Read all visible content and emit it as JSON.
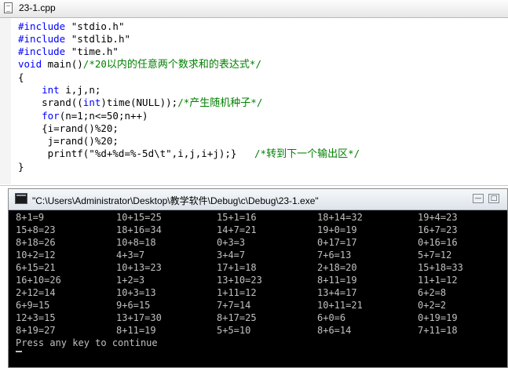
{
  "editor": {
    "title": "23-1.cpp",
    "lines": [
      [
        {
          "t": "#include",
          "c": "kw"
        },
        {
          "t": " \"stdio.h\""
        }
      ],
      [
        {
          "t": "#include",
          "c": "kw"
        },
        {
          "t": " \"stdlib.h\""
        }
      ],
      [
        {
          "t": "#include",
          "c": "kw"
        },
        {
          "t": " \"time.h\""
        }
      ],
      [
        {
          "t": "void",
          "c": "kw"
        },
        {
          "t": " main()"
        },
        {
          "t": "/*20",
          "c": "cm"
        },
        {
          "t": "以内的任意两个数求和的表达式",
          "c": "cmz"
        },
        {
          "t": "*/",
          "c": "cm"
        }
      ],
      [
        {
          "t": "{"
        }
      ],
      [
        {
          "t": "    "
        },
        {
          "t": "int",
          "c": "kw"
        },
        {
          "t": " i,j,n;"
        }
      ],
      [
        {
          "t": "    srand(("
        },
        {
          "t": "int",
          "c": "kw"
        },
        {
          "t": ")time(NULL));"
        },
        {
          "t": "/*",
          "c": "cm"
        },
        {
          "t": "产生随机种子",
          "c": "cmz"
        },
        {
          "t": "*/",
          "c": "cm"
        }
      ],
      [
        {
          "t": "    "
        },
        {
          "t": "for",
          "c": "kw"
        },
        {
          "t": "(n=1;n<=50;n++)"
        }
      ],
      [
        {
          "t": "    {i=rand()%20;"
        }
      ],
      [
        {
          "t": "     j=rand()%20;"
        }
      ],
      [
        {
          "t": "     printf(\"%d+%d=%-5d\\t\",i,j,i+j);}   "
        },
        {
          "t": "/*",
          "c": "cm"
        },
        {
          "t": "转到下一个输出区",
          "c": "cmz"
        },
        {
          "t": "*/",
          "c": "cm"
        }
      ],
      [
        {
          "t": "}"
        }
      ]
    ]
  },
  "console": {
    "title": "\"C:\\Users\\Administrator\\Desktop\\教学软件\\Debug\\c\\Debug\\23-1.exe\"",
    "buttons": {
      "minimize": "—",
      "maximize": "□"
    },
    "rows": [
      [
        "8+1=9",
        "10+15=25",
        "15+1=16",
        "18+14=32",
        "19+4=23"
      ],
      [
        "15+8=23",
        "18+16=34",
        "14+7=21",
        "19+0=19",
        "16+7=23"
      ],
      [
        "8+18=26",
        "10+8=18",
        "0+3=3",
        "0+17=17",
        "0+16=16"
      ],
      [
        "10+2=12",
        "4+3=7",
        "3+4=7",
        "7+6=13",
        "5+7=12"
      ],
      [
        "6+15=21",
        "10+13=23",
        "17+1=18",
        "2+18=20",
        "15+18=33"
      ],
      [
        "16+10=26",
        "1+2=3",
        "13+10=23",
        "8+11=19",
        "11+1=12"
      ],
      [
        "2+12=14",
        "10+3=13",
        "1+11=12",
        "13+4=17",
        "6+2=8"
      ],
      [
        "6+9=15",
        "9+6=15",
        "7+7=14",
        "10+11=21",
        "0+2=2"
      ],
      [
        "12+3=15",
        "13+17=30",
        "8+17=25",
        "6+0=6",
        "0+19=19"
      ],
      [
        "8+19=27",
        "8+11=19",
        "5+5=10",
        "8+6=14",
        "7+11=18"
      ]
    ],
    "footer": "Press any key to continue"
  }
}
